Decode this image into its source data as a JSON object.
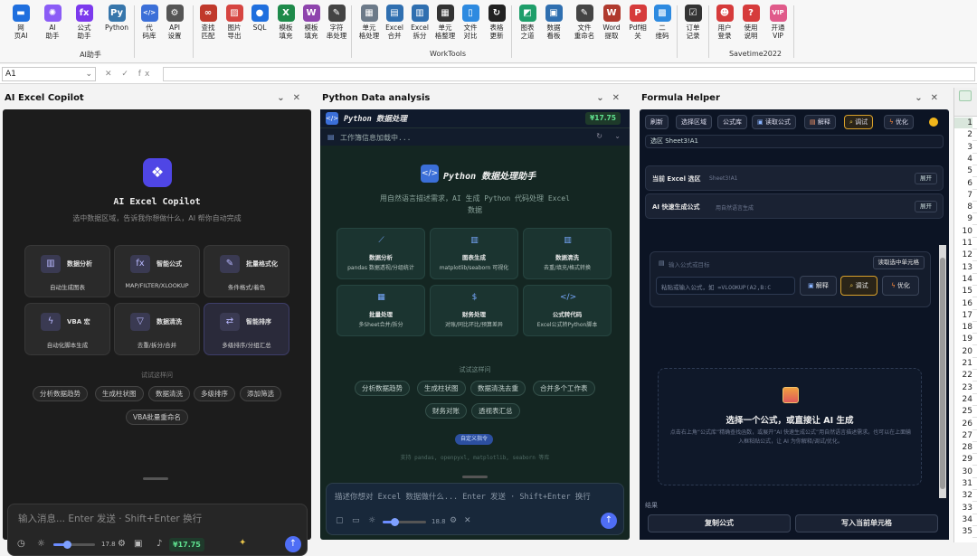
{
  "ribbon": {
    "buttons": [
      {
        "label": "网\n页AI",
        "icon": "chat-icon",
        "color": "#1f6fde"
      },
      {
        "label": "AI\n助手",
        "icon": "ai-spiral-icon",
        "color": "#8b5cf6"
      },
      {
        "label": "公式\n助手",
        "icon": "fx-icon",
        "color": "#7c3aed"
      },
      {
        "label": "Python",
        "icon": "python-icon",
        "color": "#3776ab"
      },
      {
        "label": "代\n码库",
        "icon": "code-icon",
        "color": "#3b6fd8"
      },
      {
        "label": "API\n设置",
        "icon": "gear-icon",
        "color": "#555555"
      },
      {
        "label": "查找\n匹配",
        "icon": "binoculars-icon",
        "color": "#c0392b"
      },
      {
        "label": "图片\n导出",
        "icon": "image-icon",
        "color": "#d64541"
      },
      {
        "label": "SQL",
        "icon": "database-icon",
        "color": "#1f6fde"
      },
      {
        "label": "模板\n填充",
        "icon": "excel-icon",
        "color": "#1e8a4a"
      },
      {
        "label": "模板\n填充",
        "icon": "word-icon",
        "color": "#8e44ad"
      },
      {
        "label": "字符\n串处理",
        "icon": "pen-icon",
        "color": "#444444"
      },
      {
        "label": "单元\n格处理",
        "icon": "grid-icon",
        "color": "#6c7a89"
      },
      {
        "label": "Excel\n合并",
        "icon": "merge-icon",
        "color": "#2f6fb0"
      },
      {
        "label": "Excel\n拆分",
        "icon": "split-icon",
        "color": "#2f6fb0"
      },
      {
        "label": "单元\n格整理",
        "icon": "table-icon",
        "color": "#333333"
      },
      {
        "label": "文件\n对比",
        "icon": "file-compare-icon",
        "color": "#2d8ae0"
      },
      {
        "label": "表格\n更新",
        "icon": "refresh-icon",
        "color": "#222222"
      },
      {
        "label": "图表\n之道",
        "icon": "chart-icon",
        "color": "#1e9e6a"
      },
      {
        "label": "数据\n看板",
        "icon": "dashboard-icon",
        "color": "#2f6fb0"
      },
      {
        "label": "文件\n重命名",
        "icon": "rename-icon",
        "color": "#444444"
      },
      {
        "label": "Word\n提取",
        "icon": "word-extract-icon",
        "color": "#b03a2e"
      },
      {
        "label": "Pdf相\n关",
        "icon": "pdf-icon",
        "color": "#d63b3b"
      },
      {
        "label": "二\n维码",
        "icon": "qrcode-icon",
        "color": "#2d8ae0"
      },
      {
        "label": "订单\n记录",
        "icon": "order-icon",
        "color": "#333333"
      },
      {
        "label": "用户\n登录",
        "icon": "user-icon",
        "color": "#d63b3b"
      },
      {
        "label": "使用\n说明",
        "icon": "help-icon",
        "color": "#d63b3b"
      },
      {
        "label": "开通\nVIP",
        "icon": "vip-icon",
        "color": "#e05a8a"
      }
    ],
    "groups": [
      "AI助手",
      "WorkTools",
      "Savetime2022"
    ]
  },
  "formula_bar": {
    "name_box": "A1",
    "icons": "✕ ✓ fx"
  },
  "copilot": {
    "title": "AI Excel Copilot",
    "heading": "AI Excel Copilot",
    "subtitle": "选中数据区域，告诉我你想做什么，AI 帮你自动完成",
    "cards": [
      {
        "title": "数据分析",
        "desc": "自动生成图表",
        "icon": "bar-chart-icon"
      },
      {
        "title": "智能公式",
        "desc": "MAP/FILTER/XLOOKUP",
        "icon": "fx-icon"
      },
      {
        "title": "批量格式化",
        "desc": "条件格式/着色",
        "icon": "pencil-icon"
      },
      {
        "title": "VBA 宏",
        "desc": "自动化脚本生成",
        "icon": "lightning-icon"
      },
      {
        "title": "数据清洗",
        "desc": "去重/拆分/合并",
        "icon": "filter-icon"
      },
      {
        "title": "智能排序",
        "desc": "多级排序/分组汇总",
        "icon": "sort-icon"
      }
    ],
    "hint": "试试这样问",
    "chips": [
      "分析数据趋势",
      "生成柱状图",
      "数据清洗",
      "多级排序",
      "添加筛选",
      "VBA批量重命名"
    ],
    "input_placeholder": "输入消息...  Enter 发送 · Shift+Enter 换行",
    "temp": "17.8",
    "price": "¥17.75"
  },
  "python": {
    "title": "Python Data analysis",
    "top_title": "Python 数据处理",
    "price": "¥17.75",
    "loading": "工作簿信息加载中...",
    "heading": "Python 数据处理助手",
    "subtitle": "用自然语言描述需求，AI 生成 Python 代码处理 Excel 数据",
    "cards": [
      {
        "title": "数据分析",
        "desc": "pandas 数据透视/分组统计",
        "icon": "line-chart-icon"
      },
      {
        "title": "图表生成",
        "desc": "matplotlib/seaborn 可视化",
        "icon": "bar-chart-icon"
      },
      {
        "title": "数据清洗",
        "desc": "去重/填充/格式转换",
        "icon": "columns-icon"
      },
      {
        "title": "批量处理",
        "desc": "多Sheet合并/拆分",
        "icon": "grid-icon"
      },
      {
        "title": "财务处理",
        "desc": "对账/同比环比/预算差异",
        "icon": "dollar-icon"
      },
      {
        "title": "公式转代码",
        "desc": "Excel公式转Python脚本",
        "icon": "code-icon"
      }
    ],
    "hint": "试试这样问",
    "chips": [
      "分析数据趋势",
      "生成柱状图",
      "数据清洗去重",
      "合并多个工作表",
      "财务对账",
      "透视表汇总"
    ],
    "badge": "自定义指令",
    "libs": "支持 pandas, openpyxl, matplotlib, seaborn 等库",
    "input_placeholder": "描述你想对 Excel 数据做什么...  Enter 发送 · Shift+Enter 换行",
    "temp": "18.8"
  },
  "formula": {
    "title": "Formula Helper",
    "toolbar": [
      "刷新",
      "选择区域",
      "公式库",
      "读取公式",
      "解释",
      "调试",
      "优化"
    ],
    "selection": "选区  Sheet3!A1",
    "sections": [
      {
        "title": "当前 Excel 选区",
        "desc": "Sheet3!A1",
        "expand": "展开"
      },
      {
        "title": "AI 快速生成公式",
        "desc": "用自然语言生成",
        "expand": "展开"
      }
    ],
    "input_label": "输入公式或目标",
    "read_cell": "读取选中单元格",
    "formula_placeholder": "粘贴或输入公式，如 =VLOOKUP(A2,B:C",
    "explain": "解释",
    "debug": "调试",
    "optimize": "优化",
    "empty_title": "选择一个公式，或直接让 AI 生成",
    "empty_desc": "点击右上角“公式库”精确查找函数，或展开“AI 快速生成公式”用自然语言描述需求。也可以在上面输入框粘贴公式，让 AI 为你解释/调试/优化。",
    "result_label": "结果",
    "copy": "复制公式",
    "write": "写入当前单元格"
  },
  "grid": {
    "rows": [
      "1",
      "2",
      "3",
      "4",
      "5",
      "6",
      "7",
      "8",
      "9",
      "10",
      "11",
      "12",
      "13",
      "14",
      "15",
      "16",
      "17",
      "18",
      "19",
      "20",
      "21",
      "22",
      "23",
      "24",
      "25",
      "26",
      "27",
      "28",
      "29",
      "30",
      "31",
      "32",
      "33",
      "34",
      "35"
    ]
  }
}
